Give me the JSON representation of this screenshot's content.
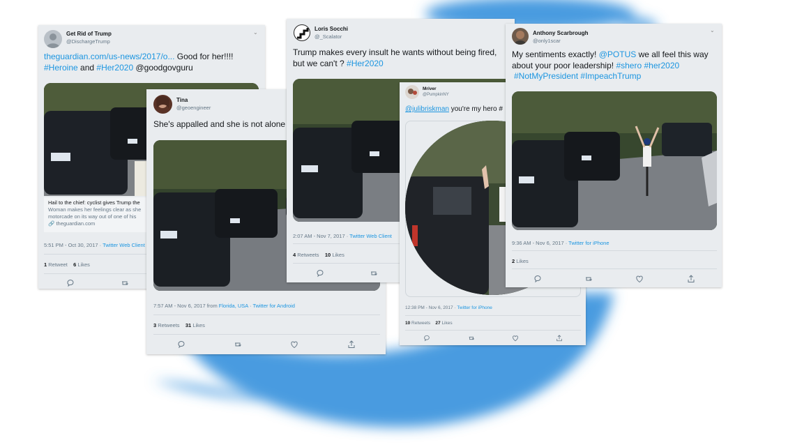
{
  "colors": {
    "link": "#1b95e0",
    "bird": "#4a9be0"
  },
  "tweets": [
    {
      "name": "Get Rid of Trump",
      "handle": "@DischargeTrump",
      "text_parts": [
        "theguardian.com/us-news/2017/o...",
        " Good for her!!!!",
        "#Heroine",
        " and ",
        "#Her2020",
        " @goodgovguru"
      ],
      "card_title": "Hail to the chief: cyclist gives Trump the",
      "card_desc": "Woman makes her feelings clear as she",
      "card_desc2": "motorcade on its way out of one of his",
      "card_domain": "theguardian.com",
      "time": "5:51 PM - Oct 30, 2017 · ",
      "source": "Twitter Web Client",
      "retweets": "1",
      "retweets_label": "Retweet",
      "likes": "6",
      "likes_label": "Likes"
    },
    {
      "name": "Tina",
      "handle": "@geoengineer",
      "text": "She's appalled and she is not alone",
      "time": "7:57 AM - Nov 6, 2017 from ",
      "place": "Florida, USA",
      "sep": " · ",
      "source": "Twitter for Android",
      "retweets": "3",
      "retweets_label": "Retweets",
      "likes": "31",
      "likes_label": "Likes"
    },
    {
      "name": "Loris Socchi",
      "handle": "@_Scalator",
      "text_a": "Trump makes every insult he wants without being fired,",
      "text_b": "but we can't ? ",
      "tag": "#Her2020",
      "time": "2:07 AM - Nov 7, 2017 · ",
      "source": "Twitter Web Client",
      "retweets": "4",
      "retweets_label": "Retweets",
      "likes": "10",
      "likes_label": "Likes"
    },
    {
      "name": "Mriver",
      "handle": "@PumpkinNY",
      "mention": "@julibriskman",
      "text": " you're my hero #",
      "time": "12:38 PM - Nov 6, 2017 · ",
      "source": "Twitter for iPhone",
      "retweets": "10",
      "retweets_label": "Retweets",
      "likes": "27",
      "likes_label": "Likes"
    },
    {
      "name": "Anthony Scarbrough",
      "handle": "@only1scar",
      "line1_a": "My sentiments exactly! ",
      "line1_m": "@POTUS",
      "line1_b": " we all feel this way",
      "line2_a": "about your poor leadership! ",
      "line2_t1": "#shero",
      "line2_t2": "#her2020",
      "line3_t1": "#NotMyPresident",
      "line3_t2": "#ImpeachTrump",
      "time": "9:36 AM - Nov 6, 2017 · ",
      "source": "Twitter for iPhone",
      "likes": "2",
      "likes_label": "Likes"
    }
  ]
}
